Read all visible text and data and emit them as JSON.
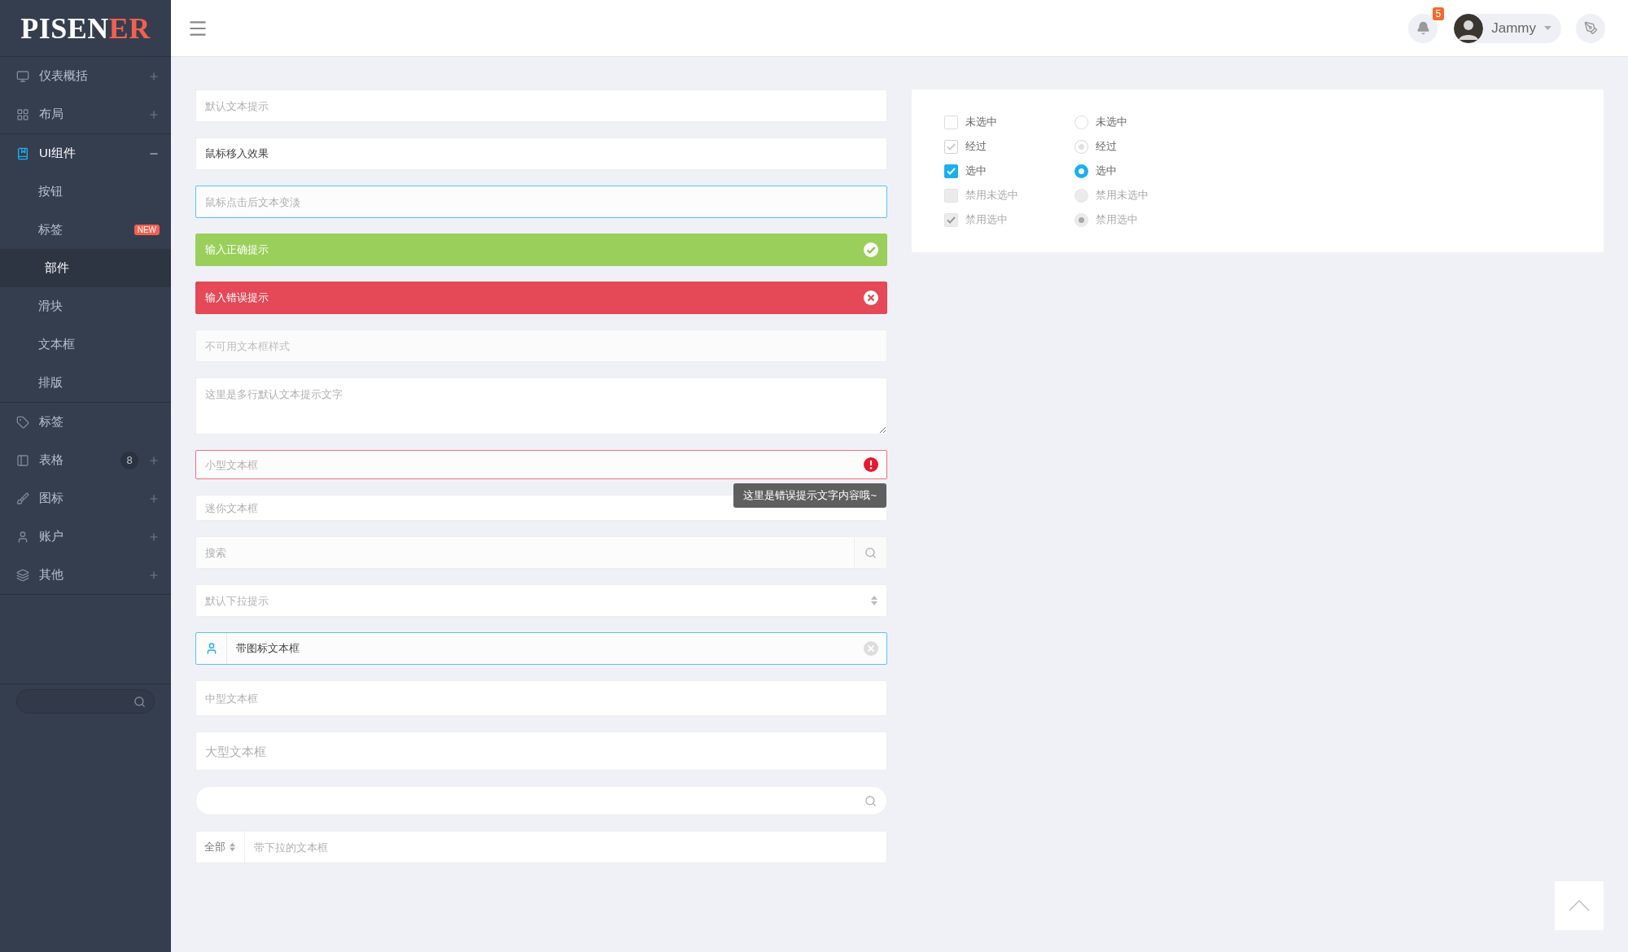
{
  "brand": {
    "name": "PISEN",
    "accent": "ER"
  },
  "header": {
    "notifications": {
      "count": "5"
    },
    "user": {
      "name": "Jammy"
    }
  },
  "sidebar": {
    "sections": [
      {
        "items": [
          {
            "label": "仪表概括",
            "kind": "group",
            "expanded": false
          },
          {
            "label": "布局",
            "kind": "group",
            "expanded": false
          }
        ]
      },
      {
        "items": [
          {
            "label": "UI组件",
            "kind": "group",
            "expanded": true,
            "children": [
              {
                "label": "按钮",
                "selected": false
              },
              {
                "label": "标签",
                "selected": false,
                "badge": "NEW"
              },
              {
                "label": "部件",
                "selected": true
              },
              {
                "label": "滑块",
                "selected": false
              },
              {
                "label": "文本框",
                "selected": false
              },
              {
                "label": "排版",
                "selected": false
              }
            ]
          }
        ]
      },
      {
        "items": [
          {
            "label": "标签",
            "kind": "link"
          },
          {
            "label": "表格",
            "kind": "group",
            "expanded": false,
            "count": "8"
          },
          {
            "label": "图标",
            "kind": "group",
            "expanded": false
          },
          {
            "label": "账户",
            "kind": "group",
            "expanded": false
          },
          {
            "label": "其他",
            "kind": "group",
            "expanded": false
          }
        ]
      }
    ]
  },
  "form": {
    "fields": [
      {
        "kind": "text",
        "placeholder": "默认文本提示",
        "focused": false,
        "disabled": false,
        "invalid": false
      },
      {
        "kind": "text",
        "value": "鼠标移入效果",
        "focused": false,
        "disabled": false,
        "invalid": false
      },
      {
        "kind": "text",
        "placeholder": "鼠标点击后文本变淡",
        "focused": true,
        "disabled": false,
        "invalid": false
      },
      {
        "kind": "success",
        "value": "输入正确提示"
      },
      {
        "kind": "error",
        "value": "输入错误提示"
      },
      {
        "kind": "text",
        "placeholder": "不可用文本框样式",
        "focused": false,
        "disabled": true,
        "invalid": false
      },
      {
        "kind": "textarea",
        "placeholder": "这里是多行默认文本提示文字"
      },
      {
        "kind": "small",
        "placeholder": "小型文本框",
        "focused": false,
        "disabled": false,
        "invalid": true,
        "tooltip": "这里是错误提示文字内容哦~"
      },
      {
        "kind": "mini",
        "placeholder": "迷你文本框",
        "focused": false,
        "disabled": false,
        "invalid": false
      },
      {
        "kind": "search",
        "placeholder": "搜索"
      },
      {
        "kind": "select",
        "placeholder": "默认下拉提示"
      },
      {
        "kind": "icon",
        "value": "带图标文本框",
        "focused": true,
        "disabled": false,
        "invalid": false
      },
      {
        "kind": "medium",
        "placeholder": "中型文本框",
        "focused": false,
        "disabled": false,
        "invalid": false
      },
      {
        "kind": "large",
        "placeholder": "大型文本框",
        "focused": false,
        "disabled": false,
        "invalid": false
      },
      {
        "kind": "round_search"
      },
      {
        "kind": "addon",
        "addon": "全部",
        "placeholder": "带下拉的文本框"
      }
    ]
  },
  "choices": {
    "checkboxes": [
      {
        "label": "未选中",
        "kind": "plain",
        "checked": false,
        "disabled": false
      },
      {
        "label": "经过",
        "kind": "hover",
        "checked": false,
        "disabled": false
      },
      {
        "label": "选中",
        "kind": "plain",
        "checked": true,
        "disabled": false
      },
      {
        "label": "禁用未选中",
        "kind": "plain",
        "checked": false,
        "disabled": true
      },
      {
        "label": "禁用选中",
        "kind": "plain",
        "checked": true,
        "disabled": true
      }
    ],
    "radios": [
      {
        "label": "未选中",
        "kind": "plain",
        "selected": false,
        "disabled": false
      },
      {
        "label": "经过",
        "kind": "hover",
        "selected": false,
        "disabled": false
      },
      {
        "label": "选中",
        "kind": "plain",
        "selected": true,
        "disabled": false
      },
      {
        "label": "禁用未选中",
        "kind": "plain",
        "selected": false,
        "disabled": true
      },
      {
        "label": "禁用选中",
        "kind": "plain",
        "selected": true,
        "disabled": true
      }
    ]
  }
}
